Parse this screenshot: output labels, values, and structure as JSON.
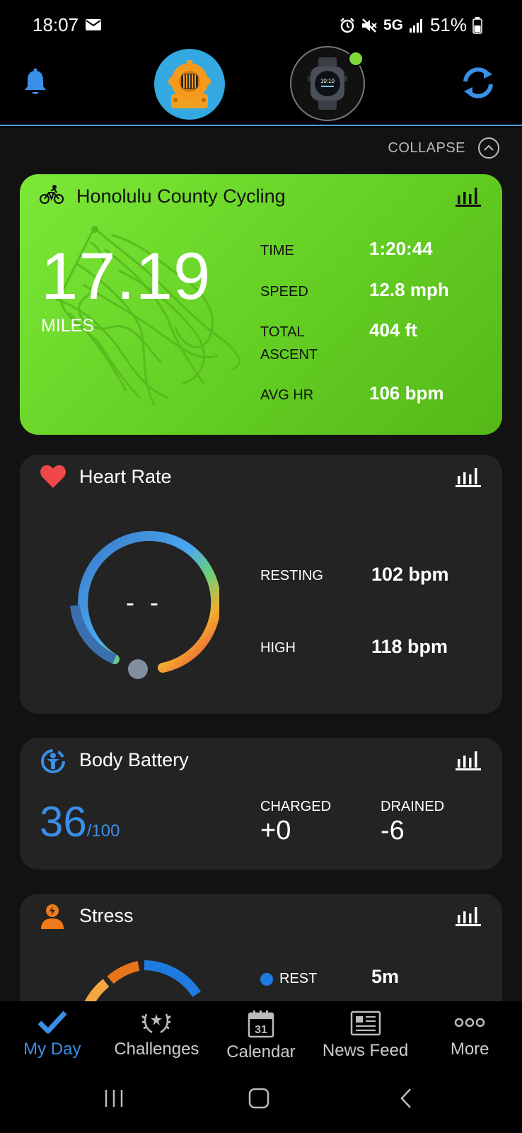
{
  "status": {
    "time": "18:07",
    "network": "5G",
    "battery": "51%"
  },
  "header": {
    "bell_icon": "bell-icon",
    "avatar_icon": "diver-helmet-icon",
    "device_icon": "watch-icon",
    "sync_icon": "sync-icon"
  },
  "collapse": {
    "label": "COLLAPSE"
  },
  "activity": {
    "title": "Honolulu County Cycling",
    "distance": "17.19",
    "distance_unit": "MILES",
    "stats": [
      {
        "label": "TIME",
        "value": "1:20:44"
      },
      {
        "label": "SPEED",
        "value": "12.8 mph"
      },
      {
        "label": "TOTAL ASCENT",
        "value": "404 ft"
      },
      {
        "label": "AVG HR",
        "value": "106 bpm"
      }
    ]
  },
  "heart_rate": {
    "title": "Heart Rate",
    "current": "- -",
    "resting_label": "RESTING",
    "resting_value": "102 bpm",
    "high_label": "HIGH",
    "high_value": "118 bpm"
  },
  "body_battery": {
    "title": "Body Battery",
    "value": "36",
    "max": "/100",
    "charged_label": "CHARGED",
    "charged_value": "+0",
    "drained_label": "DRAINED",
    "drained_value": "-6"
  },
  "stress": {
    "title": "Stress",
    "rest_label": "REST",
    "rest_value": "5m"
  },
  "nav": [
    {
      "label": "My Day",
      "icon": "checkmark-icon",
      "active": true
    },
    {
      "label": "Challenges",
      "icon": "laurel-icon",
      "active": false
    },
    {
      "label": "Calendar",
      "icon": "calendar-icon",
      "day": "31",
      "active": false
    },
    {
      "label": "News Feed",
      "icon": "newspaper-icon",
      "active": false
    },
    {
      "label": "More",
      "icon": "more-icon",
      "active": false
    }
  ],
  "colors": {
    "accent": "#3a8fe8",
    "activity_green": "#6ad82a",
    "heart_red": "#f04848",
    "stress_orange": "#f07a1a"
  }
}
